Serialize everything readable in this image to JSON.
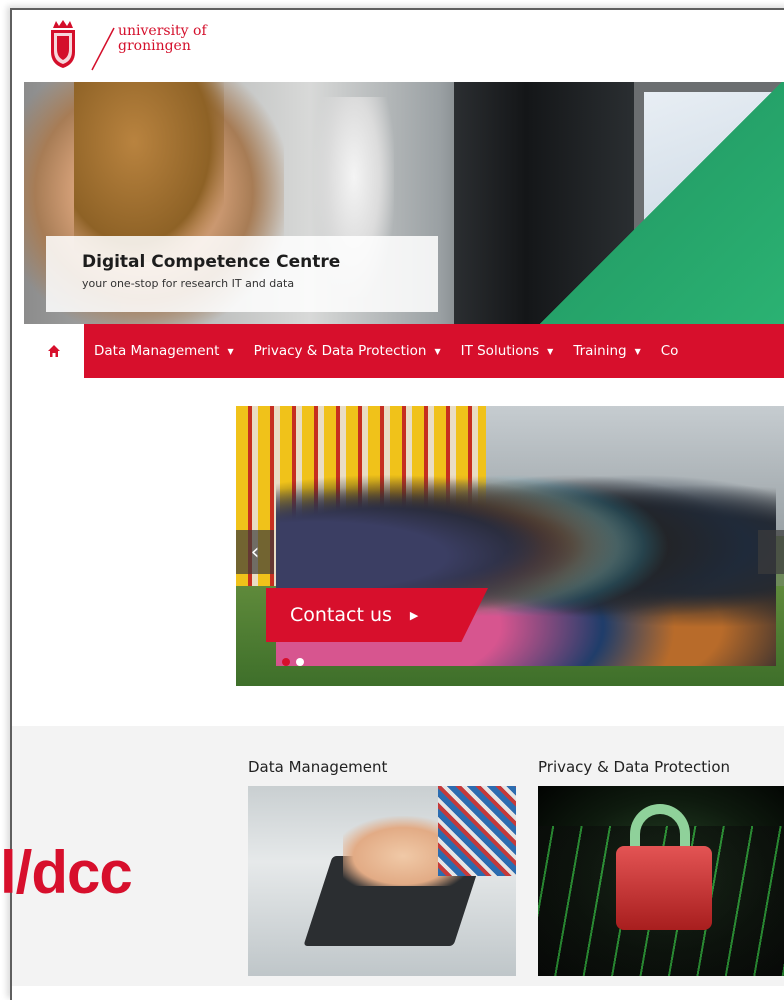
{
  "header": {
    "logo_line1": "university of",
    "logo_line2": "groningen"
  },
  "hero": {
    "title": "Digital Competence Centre",
    "subtitle": "your one-stop for research IT and data"
  },
  "nav": {
    "home_icon": "home-icon",
    "items": [
      {
        "label": "Data Management"
      },
      {
        "label": "Privacy & Data Protection"
      },
      {
        "label": "IT Solutions"
      },
      {
        "label": "Training"
      },
      {
        "label": "Co"
      }
    ]
  },
  "carousel": {
    "prev_glyph": "‹",
    "contact_label": "Contact us",
    "contact_arrow": "▶",
    "slides": 2,
    "active_slide": 1
  },
  "cards": [
    {
      "title": "Data Management"
    },
    {
      "title": "Privacy & Data Protection"
    }
  ],
  "overlay": {
    "text": "l/dcc"
  },
  "colors": {
    "brand_red": "#d70f2c",
    "band_grey": "#f3f3f3"
  }
}
